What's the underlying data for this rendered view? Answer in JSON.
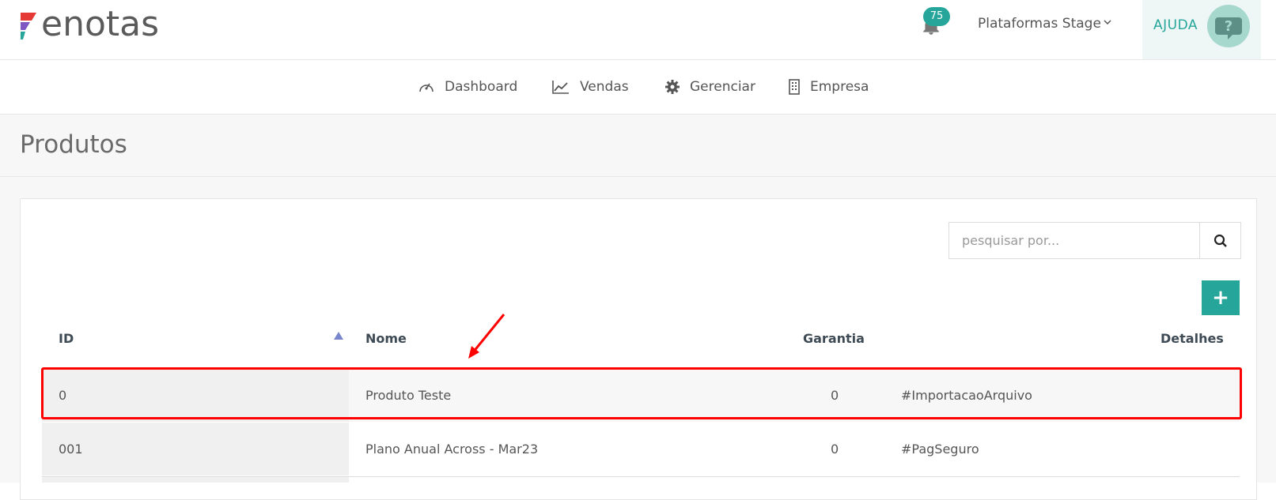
{
  "header": {
    "logo_text": "enotas",
    "notification_count": "75",
    "company_name": "Plataformas Stage",
    "help_label": "AJUDA"
  },
  "nav": {
    "items": [
      {
        "label": "Dashboard",
        "icon": "dashboard-icon"
      },
      {
        "label": "Vendas",
        "icon": "chart-icon"
      },
      {
        "label": "Gerenciar",
        "icon": "gear-icon"
      },
      {
        "label": "Empresa",
        "icon": "building-icon"
      }
    ]
  },
  "page": {
    "title": "Produtos"
  },
  "search": {
    "placeholder": "pesquisar por..."
  },
  "table": {
    "columns": [
      "ID",
      "Nome",
      "Garantia",
      "Detalhes"
    ],
    "rows": [
      {
        "id": "0",
        "nome": "Produto Teste",
        "garantia": "0",
        "detalhes": "#ImportacaoArquivo"
      },
      {
        "id": "001",
        "nome": "Plano Anual Across - Mar23",
        "garantia": "0",
        "detalhes": "#PagSeguro"
      }
    ]
  },
  "colors": {
    "accent": "#26a69a",
    "highlight": "#ff0000",
    "sort_arrow": "#7986cb"
  }
}
